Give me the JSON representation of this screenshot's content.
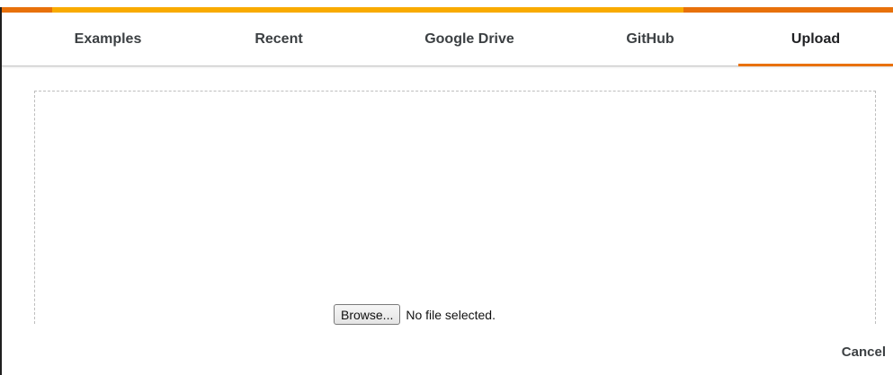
{
  "colors": {
    "accent_orange": "#e8710a",
    "accent_yellow": "#f9ab00",
    "active_tab_underline": "#e8710a"
  },
  "tabs": [
    {
      "label": "Examples",
      "active": false
    },
    {
      "label": "Recent",
      "active": false
    },
    {
      "label": "Google Drive",
      "active": false
    },
    {
      "label": "GitHub",
      "active": false
    },
    {
      "label": "Upload",
      "active": true
    }
  ],
  "upload": {
    "browse_label": "Browse...",
    "file_status": "No file selected."
  },
  "footer": {
    "cancel_label": "Cancel"
  }
}
